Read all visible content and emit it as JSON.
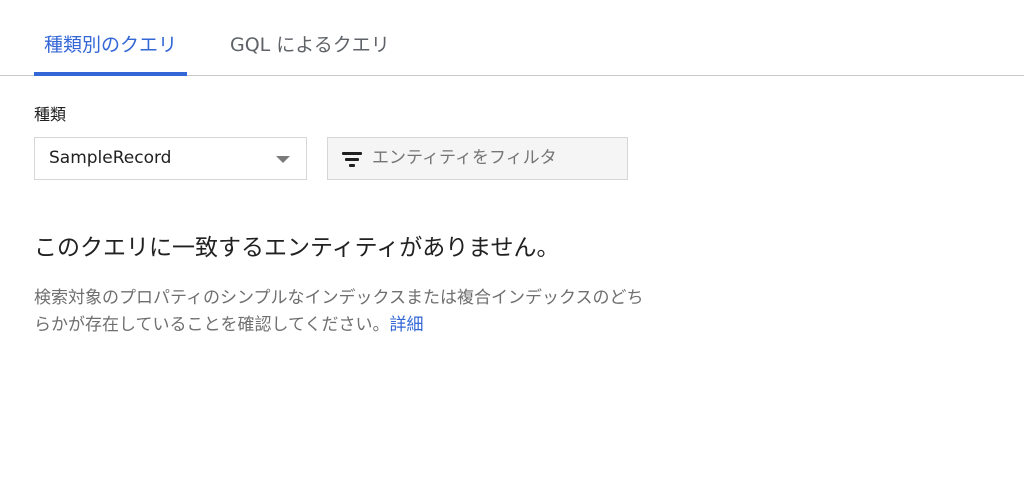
{
  "tabs": {
    "kind_query": "種類別のクエリ",
    "gql_query": "GQL によるクエリ"
  },
  "kind_section": {
    "label": "種類",
    "selected_kind": "SampleRecord"
  },
  "filter": {
    "label": "エンティティをフィルタ",
    "icon": "filter-icon"
  },
  "empty_state": {
    "title": "このクエリに一致するエンティティがありません。",
    "description_line1": "検索対象のプロパティのシンプルなインデックスまたは複合インデックスのどち",
    "description_line2": "らかが存在していることを確認してください。",
    "link": "詳細"
  },
  "colors": {
    "accent": "#3367d6",
    "muted_text": "#6f6f6f",
    "border": "#d6d6d6"
  }
}
